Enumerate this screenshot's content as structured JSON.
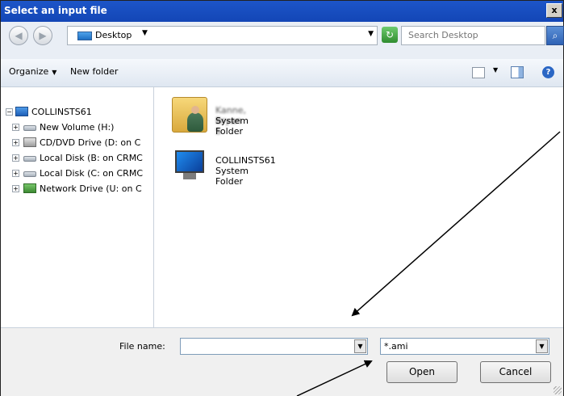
{
  "window": {
    "title": "Select an input file",
    "close_glyph": "x"
  },
  "address": {
    "location": "Desktop",
    "search_placeholder": "Search Desktop"
  },
  "toolbar": {
    "organize": "Organize",
    "new_folder": "New folder"
  },
  "tree": {
    "root": "COLLINSTS61",
    "items": [
      {
        "label": "New Volume (H:)",
        "icon": "drive-icon"
      },
      {
        "label": "CD/DVD Drive (D: on C",
        "icon": "cd-drive-icon"
      },
      {
        "label": "Local Disk (B: on CRMC",
        "icon": "drive-icon"
      },
      {
        "label": "Local Disk (C: on CRMC",
        "icon": "drive-icon"
      },
      {
        "label": "Network Drive (U: on C",
        "icon": "network-drive-icon"
      }
    ]
  },
  "content": {
    "items": [
      {
        "name": "Kanne, Bryan S",
        "type": "System Folder",
        "icon": "user-folder-icon"
      },
      {
        "name": "COLLINSTS61",
        "type": "System Folder",
        "icon": "computer-icon"
      }
    ]
  },
  "bottom": {
    "file_name_label": "File name:",
    "file_name_value": "",
    "file_type": "*.ami",
    "open": "Open",
    "cancel": "Cancel"
  }
}
